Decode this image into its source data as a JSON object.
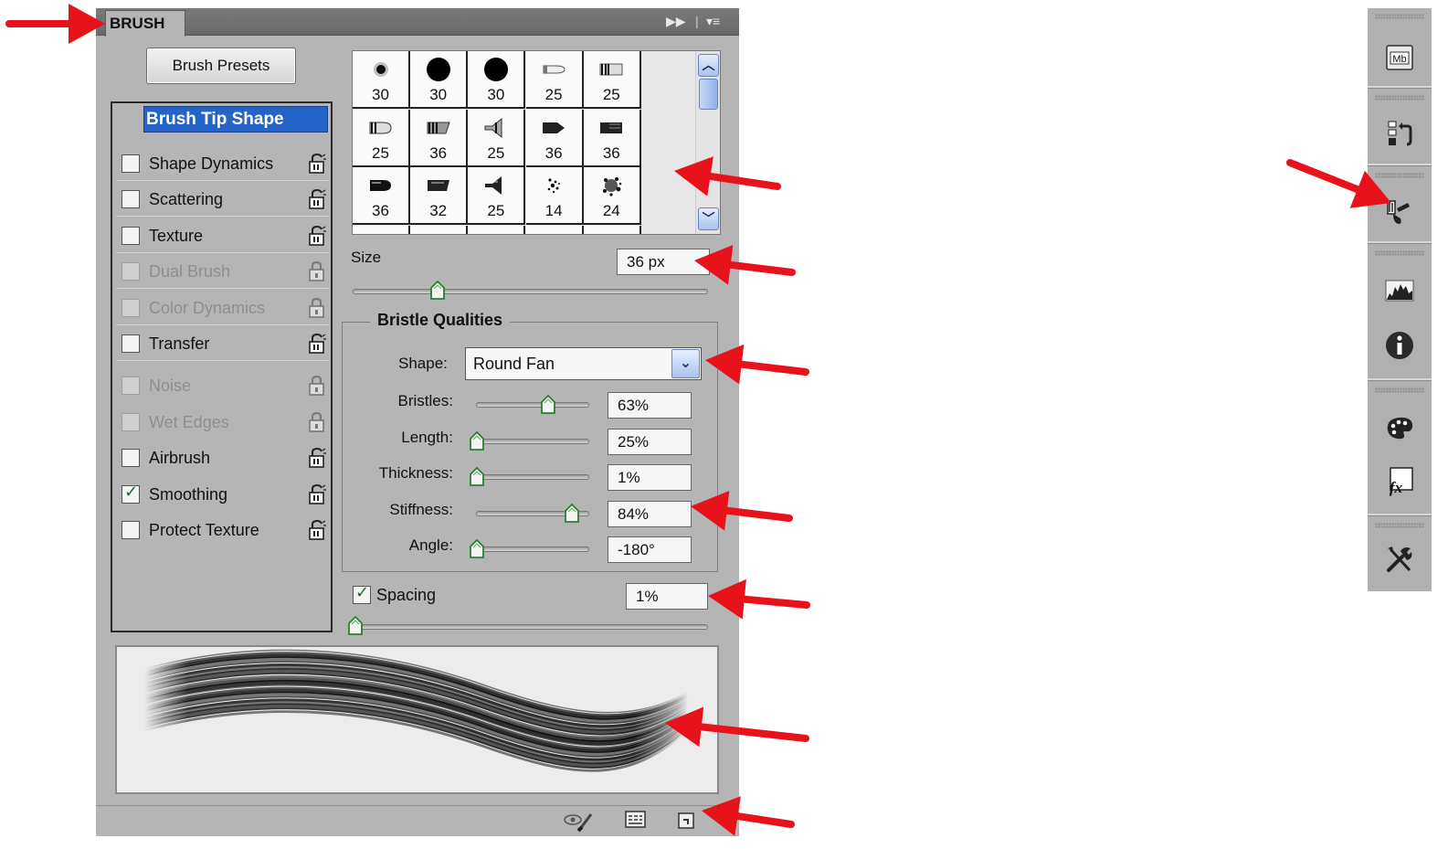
{
  "panel": {
    "tab_title": "BRUSH",
    "header_icons": {
      "collapse": "double-chevron-right-icon",
      "menu": "panel-menu-icon"
    },
    "presets_button": "Brush Presets",
    "selected_item": "Brush Tip Shape",
    "options": [
      {
        "label": "Shape Dynamics",
        "checked": false,
        "enabled": true
      },
      {
        "label": "Scattering",
        "checked": false,
        "enabled": true
      },
      {
        "label": "Texture",
        "checked": false,
        "enabled": true
      },
      {
        "label": "Dual Brush",
        "checked": false,
        "enabled": false
      },
      {
        "label": "Color Dynamics",
        "checked": false,
        "enabled": false
      },
      {
        "label": "Transfer",
        "checked": false,
        "enabled": true
      },
      {
        "label": "Noise",
        "checked": false,
        "enabled": false
      },
      {
        "label": "Wet Edges",
        "checked": false,
        "enabled": false
      },
      {
        "label": "Airbrush",
        "checked": false,
        "enabled": true
      },
      {
        "label": "Smoothing",
        "checked": true,
        "enabled": true
      },
      {
        "label": "Protect Texture",
        "checked": false,
        "enabled": true
      }
    ],
    "brush_grid": {
      "rows": [
        [
          "30",
          "30",
          "30",
          "25",
          "25"
        ],
        [
          "25",
          "36",
          "25",
          "36",
          "36"
        ],
        [
          "36",
          "32",
          "25",
          "14",
          "24"
        ]
      ]
    },
    "size": {
      "label": "Size",
      "value": "36 px",
      "slider_fraction": 0.24
    },
    "bristle": {
      "title": "Bristle Qualities",
      "shape_label": "Shape:",
      "shape_value": "Round Fan",
      "rows": [
        {
          "label": "Bristles:",
          "value": "63%",
          "fraction": 0.63
        },
        {
          "label": "Length:",
          "value": "25%",
          "fraction": 0.0
        },
        {
          "label": "Thickness:",
          "value": "1%",
          "fraction": 0.0
        },
        {
          "label": "Stiffness:",
          "value": "84%",
          "fraction": 0.84
        },
        {
          "label": "Angle:",
          "value": "-180°",
          "fraction": 0.0
        }
      ]
    },
    "spacing": {
      "label": "Spacing",
      "checked": true,
      "value": "1%",
      "slider_fraction": 0.0
    },
    "footer_icons": [
      "toggle-live-tip-preview-icon",
      "brush-grid-icon",
      "create-new-brush-icon"
    ]
  },
  "dock": {
    "items": [
      "mini-bridge-icon",
      "history-icon",
      "brush-panel-icon",
      "histogram-icon",
      "info-icon",
      "color-palette-icon",
      "fx-styles-icon",
      "tools-icon"
    ]
  },
  "colors": {
    "highlight": "#2464c8",
    "arrow": "#e8121a",
    "panel": "#b5b5b5"
  }
}
